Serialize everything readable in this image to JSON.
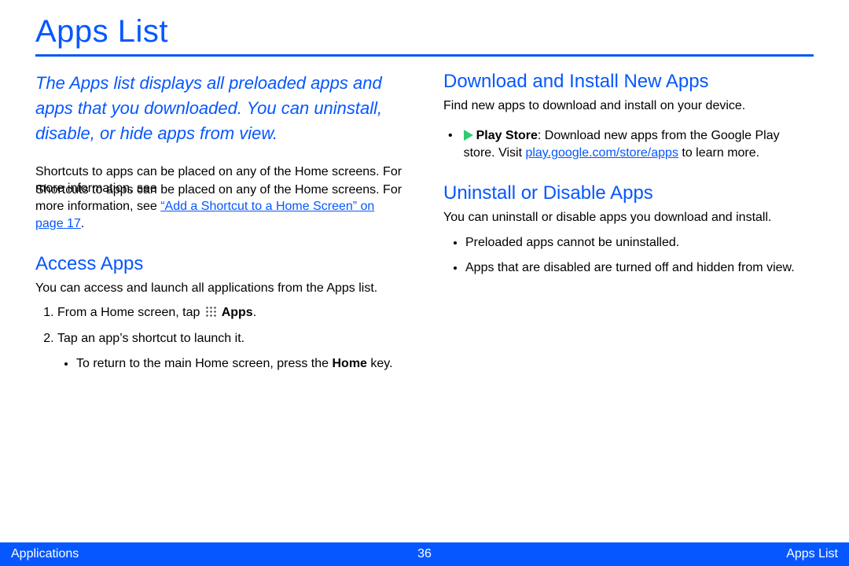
{
  "title": "Apps List",
  "intro": "The Apps list displays all preloaded apps and apps that you downloaded. You can uninstall, disable, or hide apps from view.",
  "left": {
    "shortcuts_p1": "Shortcuts to apps can be placed on any of the Home screens. For more information, see ",
    "shortcuts_link": "“Add a Shortcut to a Home Screen” on page 17",
    "shortcuts_p2": ".",
    "access_heading": "Access Apps",
    "access_intro": "You can access and launch all applications from the Apps list.",
    "step1_a": "From a Home screen, tap ",
    "step1_b": " Apps",
    "step1_c": ".",
    "step2": "Tap an app’s shortcut to launch it.",
    "step2_sub_a": "To return to the main Home screen, press the ",
    "step2_sub_b": "Home",
    "step2_sub_c": " key."
  },
  "right": {
    "download_heading": "Download and Install New Apps",
    "download_intro": "Find new apps to download and install on your device.",
    "play_label": "Play Store",
    "play_text_a": ": Download new apps from the Google Play store. Visit ",
    "play_link": "play.google.com/store/apps",
    "play_text_b": " to learn more.",
    "uninstall_heading": "Uninstall or Disable Apps",
    "uninstall_intro": "You can uninstall or disable apps you download and install.",
    "uninstall_b1": "Preloaded apps cannot be uninstalled.",
    "uninstall_b2": "Apps that are disabled are turned off and hidden from view."
  },
  "footer": {
    "left": "Applications",
    "center": "36",
    "right": "Apps List"
  }
}
